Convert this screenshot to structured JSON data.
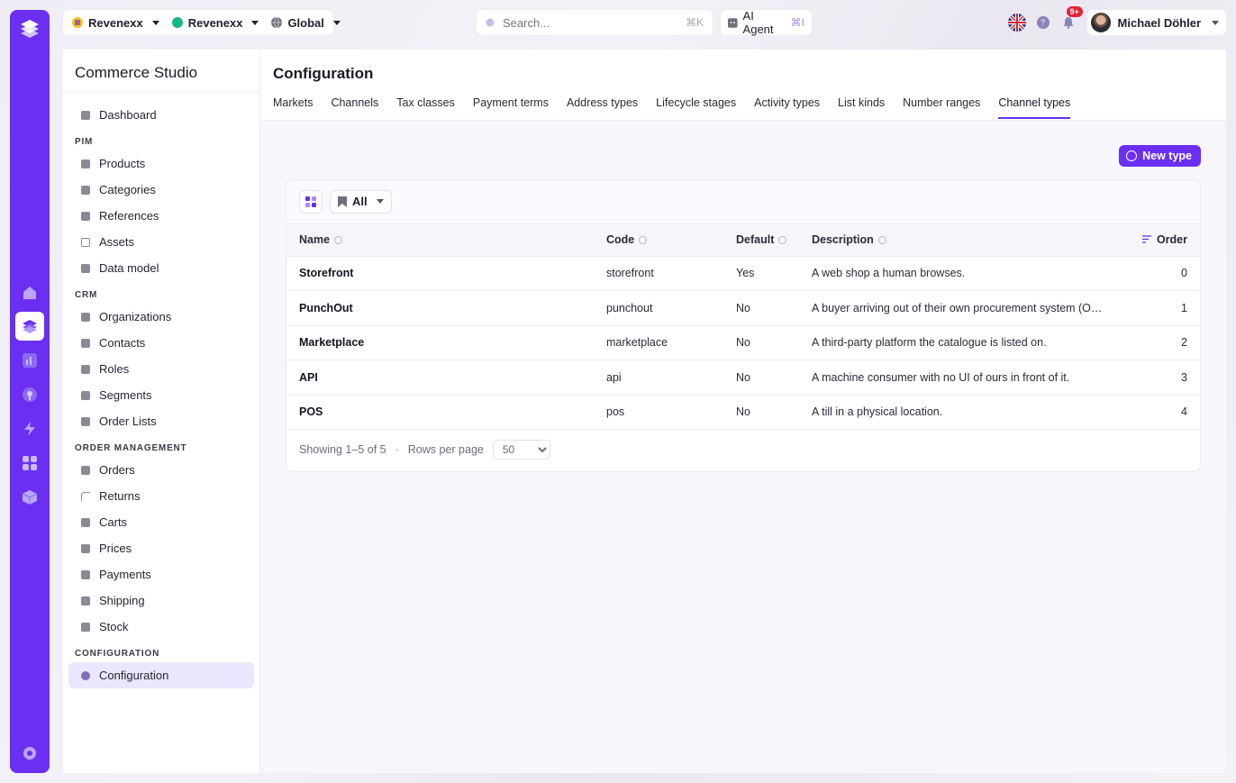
{
  "topbar": {
    "switchers": [
      {
        "label": "Revenexx",
        "icon": "revenexx-logo-icon"
      },
      {
        "label": "Revenexx",
        "icon": "green-dot-icon",
        "color": "#13b981"
      },
      {
        "label": "Global",
        "icon": "globe-icon"
      }
    ],
    "search": {
      "placeholder": "Search...",
      "shortcut": "⌘K"
    },
    "agent": {
      "label": "AI Agent",
      "shortcut": "⌘I"
    },
    "notifications": {
      "badge": "9+"
    },
    "user": {
      "name": "Michael Döhler"
    }
  },
  "sidebar": {
    "title": "Commerce Studio",
    "top_items": [
      {
        "label": "Dashboard"
      }
    ],
    "sections": [
      {
        "title": "PIM",
        "items": [
          {
            "label": "Products"
          },
          {
            "label": "Categories"
          },
          {
            "label": "References"
          },
          {
            "label": "Assets"
          },
          {
            "label": "Data model"
          }
        ]
      },
      {
        "title": "CRM",
        "items": [
          {
            "label": "Organizations"
          },
          {
            "label": "Contacts"
          },
          {
            "label": "Roles"
          },
          {
            "label": "Segments"
          },
          {
            "label": "Order Lists"
          }
        ]
      },
      {
        "title": "ORDER MANAGEMENT",
        "items": [
          {
            "label": "Orders"
          },
          {
            "label": "Returns"
          },
          {
            "label": "Carts"
          },
          {
            "label": "Prices"
          },
          {
            "label": "Payments"
          },
          {
            "label": "Shipping"
          },
          {
            "label": "Stock"
          }
        ]
      },
      {
        "title": "CONFIGURATION",
        "items": [
          {
            "label": "Configuration",
            "active": true
          }
        ]
      }
    ]
  },
  "main": {
    "title": "Configuration",
    "tabs": [
      {
        "label": "Markets"
      },
      {
        "label": "Channels"
      },
      {
        "label": "Tax classes"
      },
      {
        "label": "Payment terms"
      },
      {
        "label": "Address types"
      },
      {
        "label": "Lifecycle stages"
      },
      {
        "label": "Activity types"
      },
      {
        "label": "List kinds"
      },
      {
        "label": "Number ranges"
      },
      {
        "label": "Channel types",
        "active": true
      }
    ],
    "new_button": "New type",
    "filter": {
      "label": "All"
    },
    "columns": {
      "name": "Name",
      "code": "Code",
      "default": "Default",
      "description": "Description",
      "order": "Order"
    },
    "rows": [
      {
        "name": "Storefront",
        "code": "storefront",
        "default": "Yes",
        "description": "A web shop a human browses.",
        "order": "0"
      },
      {
        "name": "PunchOut",
        "code": "punchout",
        "default": "No",
        "description": "A buyer arriving out of their own procurement system (OCI, c...",
        "order": "1"
      },
      {
        "name": "Marketplace",
        "code": "marketplace",
        "default": "No",
        "description": "A third-party platform the catalogue is listed on.",
        "order": "2"
      },
      {
        "name": "API",
        "code": "api",
        "default": "No",
        "description": "A machine consumer with no UI of ours in front of it.",
        "order": "3"
      },
      {
        "name": "POS",
        "code": "pos",
        "default": "No",
        "description": "A till in a physical location.",
        "order": "4"
      }
    ],
    "pager": {
      "showing": "Showing 1–5 of 5",
      "separator": "-",
      "rows_per_page_label": "Rows per page",
      "rows_per_page": "50"
    }
  },
  "colors": {
    "accent": "#6a2ff0",
    "badge": "#e5213a"
  }
}
